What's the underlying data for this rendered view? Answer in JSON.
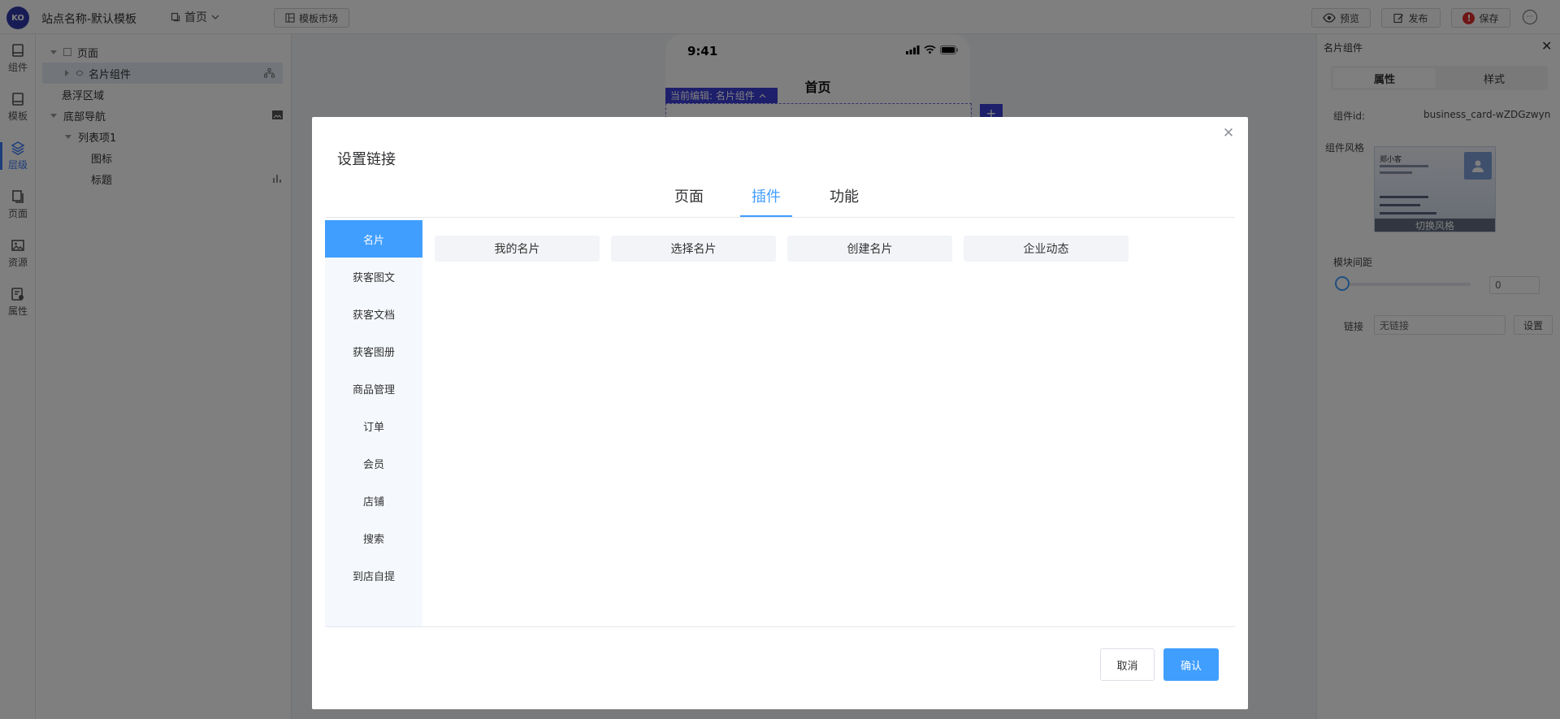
{
  "topbar": {
    "logo_text": "KO",
    "site_name": "站点名称-默认模板",
    "page_select": "首页",
    "market_label": "模板市场",
    "preview_label": "预览",
    "publish_label": "发布",
    "save_label": "保存",
    "save_badge": "!"
  },
  "rail": {
    "items": [
      {
        "label": "组件",
        "icon": "component-icon"
      },
      {
        "label": "模板",
        "icon": "template-icon"
      },
      {
        "label": "层级",
        "icon": "layers-icon"
      },
      {
        "label": "页面",
        "icon": "page-icon"
      },
      {
        "label": "资源",
        "icon": "image-icon"
      },
      {
        "label": "属性",
        "icon": "settings-icon"
      }
    ],
    "active_index": 2
  },
  "tree": {
    "rows": [
      {
        "label": "页面"
      },
      {
        "label": "名片组件"
      },
      {
        "label": "悬浮区域"
      },
      {
        "label": "底部导航"
      },
      {
        "label": "列表项1"
      },
      {
        "label": "图标"
      },
      {
        "label": "标题"
      }
    ]
  },
  "phone": {
    "time": "9:41",
    "title": "首页",
    "edit_tag": "当前编辑: 名片组件",
    "add_label": "+"
  },
  "props": {
    "title": "名片组件",
    "tabs": [
      "属性",
      "样式"
    ],
    "component_id_label": "组件id:",
    "component_id": "business_card-wZDGzwyn",
    "style_label": "组件风格",
    "style_card_name": "郑小客",
    "style_switch": "切换风格",
    "spacing_label": "模块间距",
    "spacing_value": "0",
    "link_label": "链接",
    "link_placeholder": "无链接",
    "link_set": "设置"
  },
  "dialog": {
    "title": "设置链接",
    "tabs": [
      "页面",
      "插件",
      "功能"
    ],
    "active_tab": 1,
    "sidebar": [
      "名片",
      "获客图文",
      "获客文档",
      "获客图册",
      "商品管理",
      "订单",
      "会员",
      "店铺",
      "搜索",
      "到店自提"
    ],
    "active_side": 0,
    "options": [
      "我的名片",
      "选择名片",
      "创建名片",
      "企业动态"
    ],
    "cancel": "取消",
    "confirm": "确认"
  },
  "colors": {
    "primary": "#409eff",
    "edit_accent": "#3b3fd6",
    "danger": "#e02c2c"
  }
}
